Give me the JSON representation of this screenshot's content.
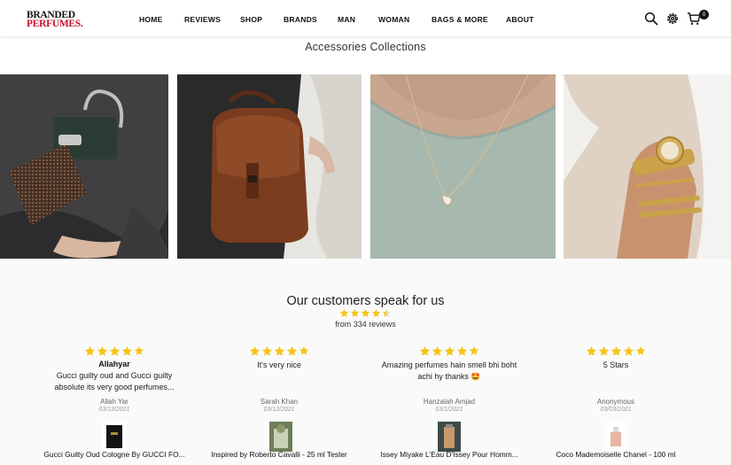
{
  "logo": {
    "line1": "BRANDED",
    "line2": "PERFUMES."
  },
  "nav": [
    "HOME",
    "REVIEWS",
    "SHOP",
    "BRANDS",
    "MAN",
    "WOMAN",
    "BAGS & MORE",
    "ABOUT"
  ],
  "header_icons": [
    "search-icon",
    "gear-icon",
    "cart-icon"
  ],
  "cart_count": "0",
  "collections": {
    "title": "Accessories Collections",
    "tiles": [
      "handbag",
      "leather-backpack",
      "heart-necklace",
      "gold-watch-bracelets"
    ]
  },
  "reviews": {
    "title": "Our customers speak for us",
    "average_rating": 4.5,
    "count_text": "from 334 reviews",
    "items": [
      {
        "stars": 5,
        "name": "Allahyar",
        "body": "Gucci guilty oud and Gucci guilty absolute its very good perfumes...",
        "author": "Allah Yar",
        "date": "03/13/2021",
        "product": "Gucci Guilty Oud Cologne By GUCCI FO..."
      },
      {
        "stars": 5,
        "name": "",
        "body": "It's very nice",
        "author": "Sarah Khan",
        "date": "03/12/2021",
        "product": "Inspired by Roberto Cavalli - 25 ml Tester"
      },
      {
        "stars": 5,
        "name": "",
        "body": "Amazing perfumes hain smell bhi boht achi hy thanks 🤩",
        "author": "Hanzalah Amjad",
        "date": "03/1/2021",
        "product": "Issey Miyake L'Eau D'Issey Pour Homm..."
      },
      {
        "stars": 5,
        "name": "",
        "body": "5 Stars",
        "author": "Anonymous",
        "date": "03/03/2021",
        "product": "Coco Mademoiselle Chanel - 100 ml"
      }
    ]
  },
  "colors": {
    "star": "#f5c518",
    "logo_red": "#c8102e",
    "text": "#222222"
  }
}
